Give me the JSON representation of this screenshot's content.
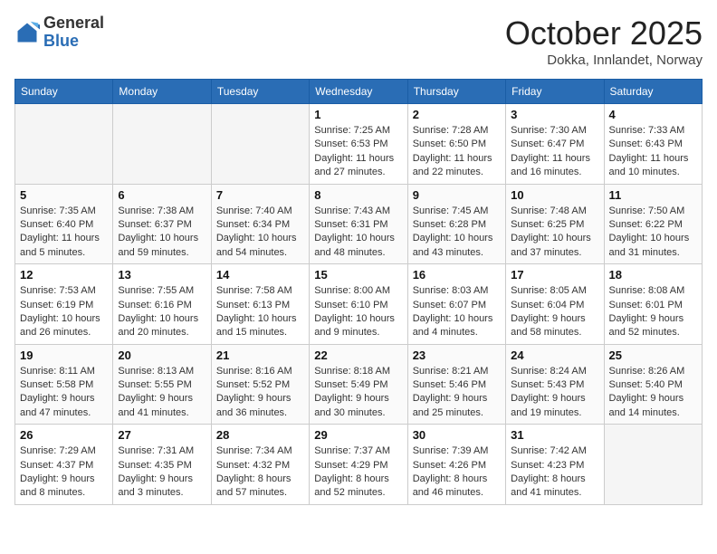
{
  "header": {
    "logo_general": "General",
    "logo_blue": "Blue",
    "month_title": "October 2025",
    "subtitle": "Dokka, Innlandet, Norway"
  },
  "weekdays": [
    "Sunday",
    "Monday",
    "Tuesday",
    "Wednesday",
    "Thursday",
    "Friday",
    "Saturday"
  ],
  "weeks": [
    [
      {
        "day": "",
        "info": ""
      },
      {
        "day": "",
        "info": ""
      },
      {
        "day": "",
        "info": ""
      },
      {
        "day": "1",
        "info": "Sunrise: 7:25 AM\nSunset: 6:53 PM\nDaylight: 11 hours and 27 minutes."
      },
      {
        "day": "2",
        "info": "Sunrise: 7:28 AM\nSunset: 6:50 PM\nDaylight: 11 hours and 22 minutes."
      },
      {
        "day": "3",
        "info": "Sunrise: 7:30 AM\nSunset: 6:47 PM\nDaylight: 11 hours and 16 minutes."
      },
      {
        "day": "4",
        "info": "Sunrise: 7:33 AM\nSunset: 6:43 PM\nDaylight: 11 hours and 10 minutes."
      }
    ],
    [
      {
        "day": "5",
        "info": "Sunrise: 7:35 AM\nSunset: 6:40 PM\nDaylight: 11 hours and 5 minutes."
      },
      {
        "day": "6",
        "info": "Sunrise: 7:38 AM\nSunset: 6:37 PM\nDaylight: 10 hours and 59 minutes."
      },
      {
        "day": "7",
        "info": "Sunrise: 7:40 AM\nSunset: 6:34 PM\nDaylight: 10 hours and 54 minutes."
      },
      {
        "day": "8",
        "info": "Sunrise: 7:43 AM\nSunset: 6:31 PM\nDaylight: 10 hours and 48 minutes."
      },
      {
        "day": "9",
        "info": "Sunrise: 7:45 AM\nSunset: 6:28 PM\nDaylight: 10 hours and 43 minutes."
      },
      {
        "day": "10",
        "info": "Sunrise: 7:48 AM\nSunset: 6:25 PM\nDaylight: 10 hours and 37 minutes."
      },
      {
        "day": "11",
        "info": "Sunrise: 7:50 AM\nSunset: 6:22 PM\nDaylight: 10 hours and 31 minutes."
      }
    ],
    [
      {
        "day": "12",
        "info": "Sunrise: 7:53 AM\nSunset: 6:19 PM\nDaylight: 10 hours and 26 minutes."
      },
      {
        "day": "13",
        "info": "Sunrise: 7:55 AM\nSunset: 6:16 PM\nDaylight: 10 hours and 20 minutes."
      },
      {
        "day": "14",
        "info": "Sunrise: 7:58 AM\nSunset: 6:13 PM\nDaylight: 10 hours and 15 minutes."
      },
      {
        "day": "15",
        "info": "Sunrise: 8:00 AM\nSunset: 6:10 PM\nDaylight: 10 hours and 9 minutes."
      },
      {
        "day": "16",
        "info": "Sunrise: 8:03 AM\nSunset: 6:07 PM\nDaylight: 10 hours and 4 minutes."
      },
      {
        "day": "17",
        "info": "Sunrise: 8:05 AM\nSunset: 6:04 PM\nDaylight: 9 hours and 58 minutes."
      },
      {
        "day": "18",
        "info": "Sunrise: 8:08 AM\nSunset: 6:01 PM\nDaylight: 9 hours and 52 minutes."
      }
    ],
    [
      {
        "day": "19",
        "info": "Sunrise: 8:11 AM\nSunset: 5:58 PM\nDaylight: 9 hours and 47 minutes."
      },
      {
        "day": "20",
        "info": "Sunrise: 8:13 AM\nSunset: 5:55 PM\nDaylight: 9 hours and 41 minutes."
      },
      {
        "day": "21",
        "info": "Sunrise: 8:16 AM\nSunset: 5:52 PM\nDaylight: 9 hours and 36 minutes."
      },
      {
        "day": "22",
        "info": "Sunrise: 8:18 AM\nSunset: 5:49 PM\nDaylight: 9 hours and 30 minutes."
      },
      {
        "day": "23",
        "info": "Sunrise: 8:21 AM\nSunset: 5:46 PM\nDaylight: 9 hours and 25 minutes."
      },
      {
        "day": "24",
        "info": "Sunrise: 8:24 AM\nSunset: 5:43 PM\nDaylight: 9 hours and 19 minutes."
      },
      {
        "day": "25",
        "info": "Sunrise: 8:26 AM\nSunset: 5:40 PM\nDaylight: 9 hours and 14 minutes."
      }
    ],
    [
      {
        "day": "26",
        "info": "Sunrise: 7:29 AM\nSunset: 4:37 PM\nDaylight: 9 hours and 8 minutes."
      },
      {
        "day": "27",
        "info": "Sunrise: 7:31 AM\nSunset: 4:35 PM\nDaylight: 9 hours and 3 minutes."
      },
      {
        "day": "28",
        "info": "Sunrise: 7:34 AM\nSunset: 4:32 PM\nDaylight: 8 hours and 57 minutes."
      },
      {
        "day": "29",
        "info": "Sunrise: 7:37 AM\nSunset: 4:29 PM\nDaylight: 8 hours and 52 minutes."
      },
      {
        "day": "30",
        "info": "Sunrise: 7:39 AM\nSunset: 4:26 PM\nDaylight: 8 hours and 46 minutes."
      },
      {
        "day": "31",
        "info": "Sunrise: 7:42 AM\nSunset: 4:23 PM\nDaylight: 8 hours and 41 minutes."
      },
      {
        "day": "",
        "info": ""
      }
    ]
  ]
}
